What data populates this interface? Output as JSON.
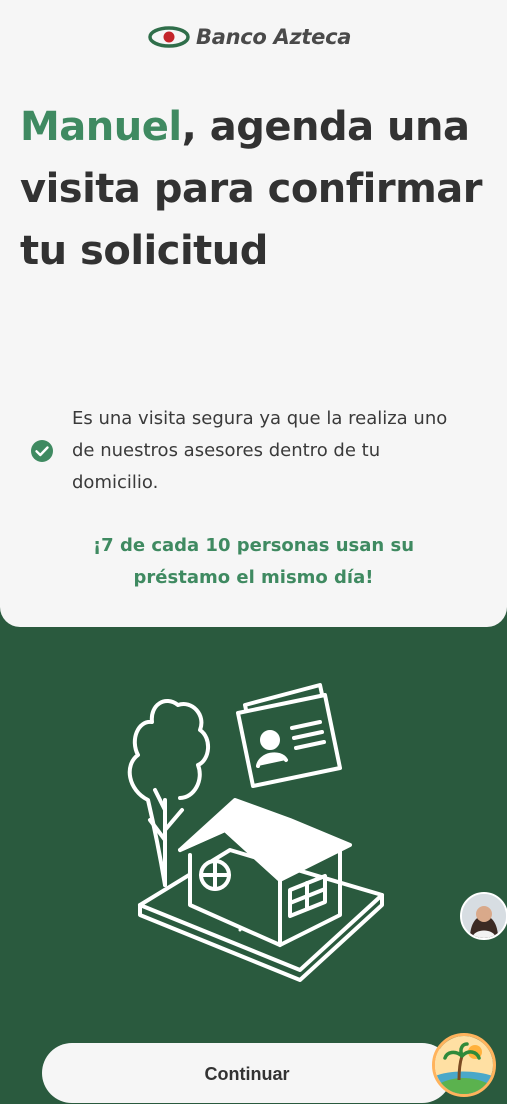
{
  "header": {
    "brand": "Banco Azteca"
  },
  "headline": {
    "name": "Manuel",
    "rest": ", agenda una visita para confirmar tu solicitud"
  },
  "info": {
    "text": "Es una visita segura ya que la realiza uno de nuestros asesores dentro de tu domicilio."
  },
  "promo": {
    "line1": "¡7 de cada 10 personas usan su",
    "line2": "préstamo el mismo día!"
  },
  "footer": {
    "continue_label": "Continuar"
  },
  "colors": {
    "brand_green": "#3f8a61",
    "dark_green": "#2a5a3e",
    "card": "#f6f6f6"
  },
  "icons": {
    "check": "check-circle-icon",
    "logo": "banco-azteca-logo-icon"
  }
}
